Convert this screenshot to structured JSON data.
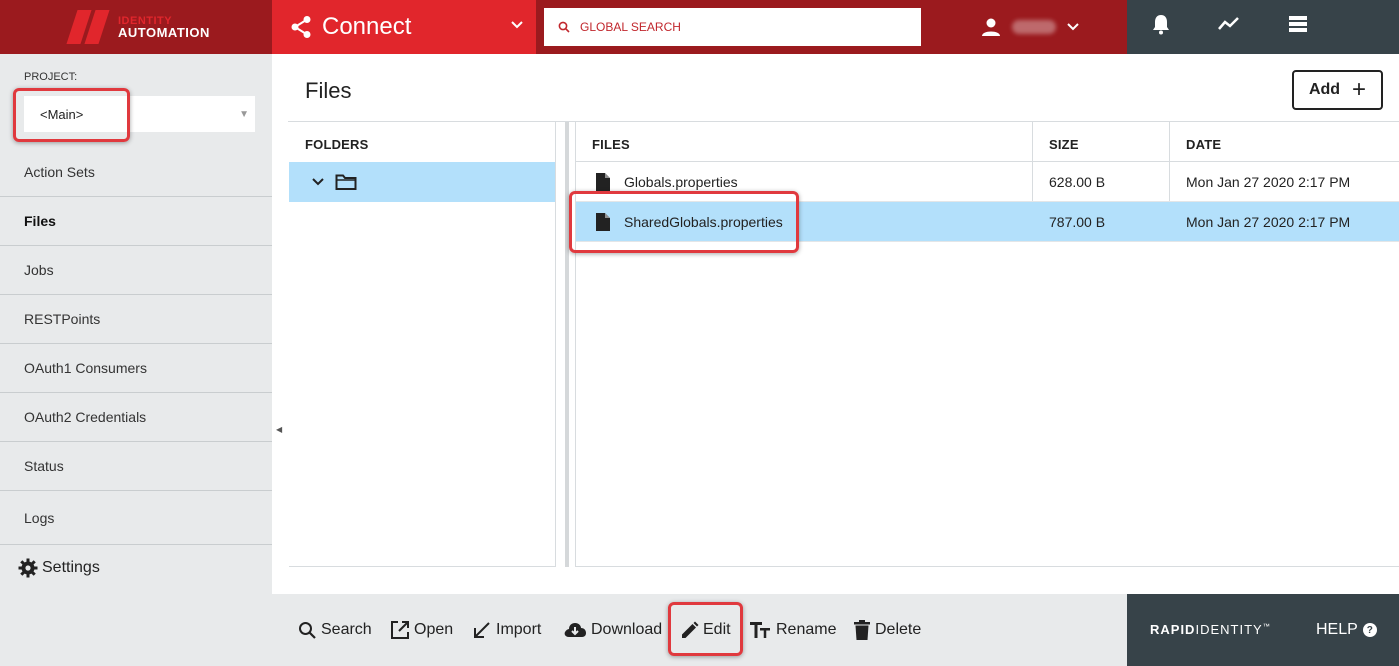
{
  "header": {
    "logo_line1": "IDENTITY",
    "logo_line2": "AUTOMATION",
    "app_name": "Connect",
    "search_placeholder": "GLOBAL SEARCH",
    "icons": [
      "share-icon",
      "chevron-down-icon",
      "search-icon",
      "user-icon",
      "bell-icon",
      "trend-icon",
      "list-icon"
    ]
  },
  "sidebar": {
    "project_label": "PROJECT:",
    "project_value": "<Main>",
    "items": [
      {
        "label": "Action Sets"
      },
      {
        "label": "Files"
      },
      {
        "label": "Jobs"
      },
      {
        "label": "RESTPoints"
      },
      {
        "label": "OAuth1 Consumers"
      },
      {
        "label": "OAuth2 Credentials"
      },
      {
        "label": "Status"
      },
      {
        "label": "Logs"
      }
    ],
    "active_item": "Files",
    "settings_label": "Settings"
  },
  "main": {
    "title": "Files",
    "add_label": "Add",
    "folders_header": "FOLDERS",
    "files_columns": {
      "name": "FILES",
      "size": "SIZE",
      "date": "DATE"
    },
    "files": [
      {
        "name": "Globals.properties",
        "size": "628.00 B",
        "date": "Mon Jan 27 2020 2:17 PM",
        "selected": false
      },
      {
        "name": "SharedGlobals.properties",
        "size": "787.00 B",
        "date": "Mon Jan 27 2020 2:17 PM",
        "selected": true
      }
    ]
  },
  "toolbar": {
    "search": "Search",
    "open": "Open",
    "import": "Import",
    "download": "Download",
    "edit": "Edit",
    "rename": "Rename",
    "delete": "Delete"
  },
  "footer": {
    "brand_bold": "RAPID",
    "brand_light": "IDENTITY",
    "brand_tm": "™",
    "help": "HELP",
    "help_glyph": "?"
  },
  "colors": {
    "header_dark_red": "#9b1a1e",
    "header_red": "#e1262c",
    "slate": "#374349",
    "selection_blue": "#b3e0fb",
    "sidebar_gray": "#e8eaeb",
    "highlight_red": "#e0393e"
  }
}
